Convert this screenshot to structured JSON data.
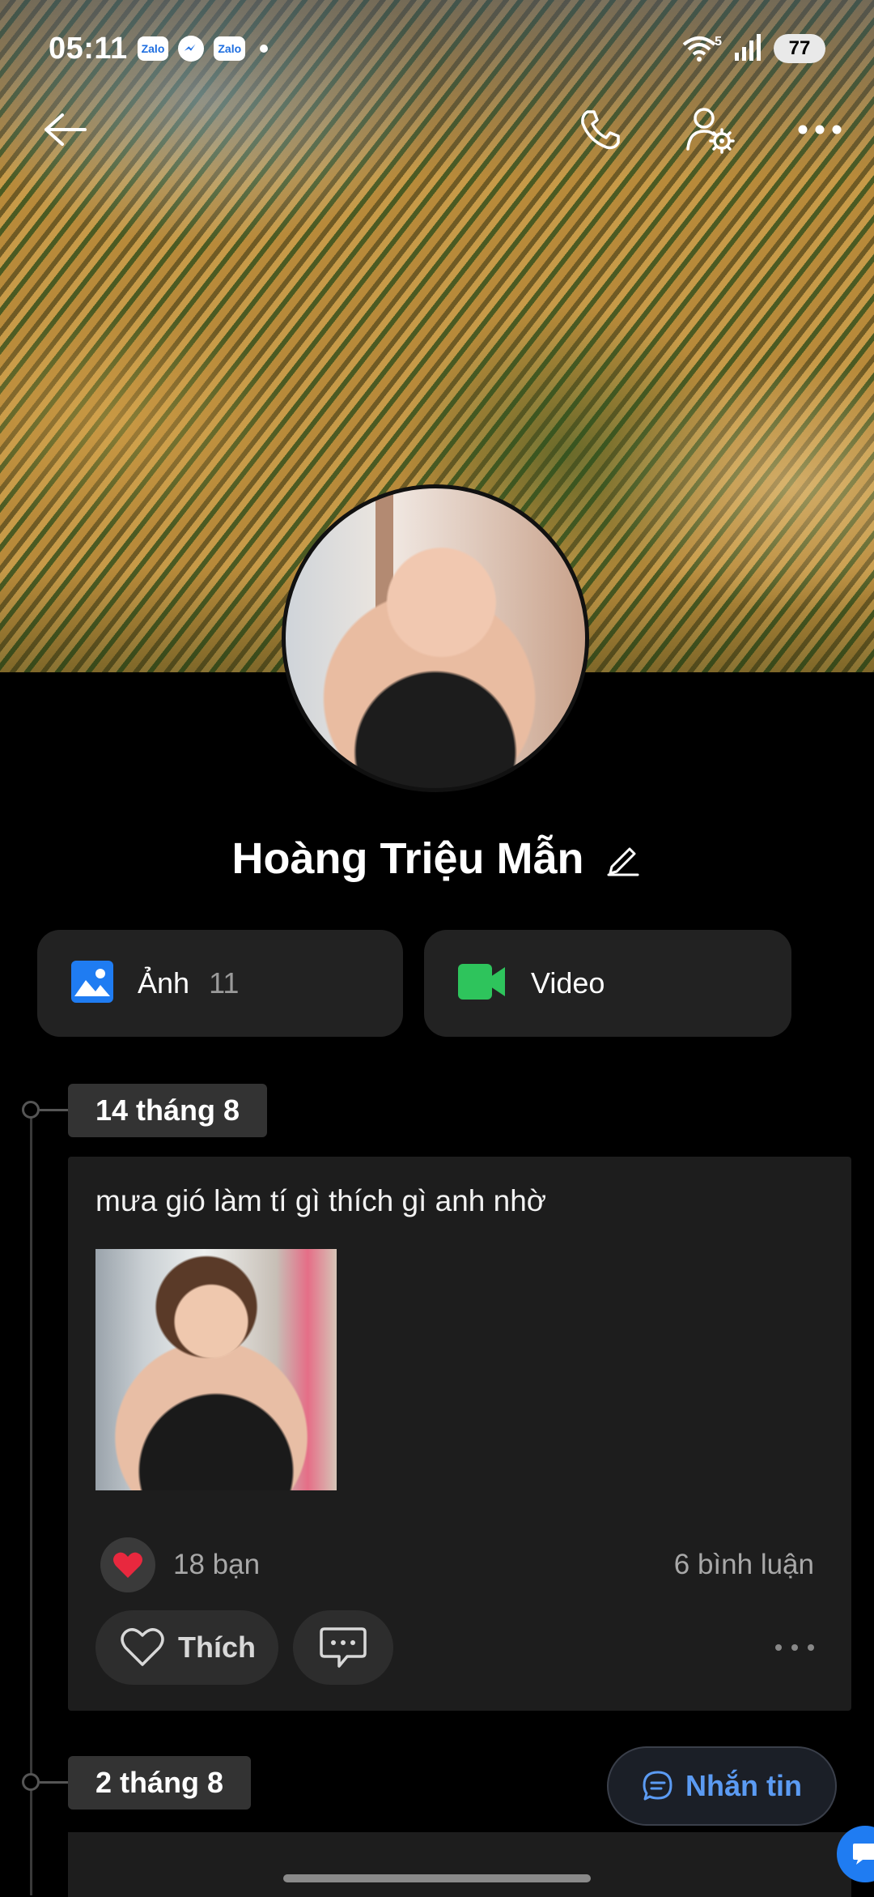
{
  "status_bar": {
    "time": "05:11",
    "notification_icons": [
      "Zalo",
      "messenger-icon",
      "Zalo"
    ],
    "wifi_label": "5",
    "battery": "77"
  },
  "profile": {
    "name": "Hoàng Triệu Mẫn"
  },
  "media": [
    {
      "label": "Ảnh",
      "count": "11",
      "icon": "photo-icon",
      "color": "#1f7cf2"
    },
    {
      "label": "Video",
      "icon": "video-icon",
      "color": "#2ec45c"
    }
  ],
  "timeline": {
    "posts": [
      {
        "date": "14 tháng 8",
        "text": "mưa gió làm tí gì thích gì anh nhờ",
        "reactions": "18 bạn",
        "comments": "6 bình luận",
        "like_label": "Thích"
      },
      {
        "date": "2 tháng 8"
      }
    ]
  },
  "actions": {
    "message_label": "Nhắn tin"
  },
  "colors": {
    "accent": "#5b9bf3",
    "heart": "#e8283e",
    "card": "#1d1d1d"
  }
}
